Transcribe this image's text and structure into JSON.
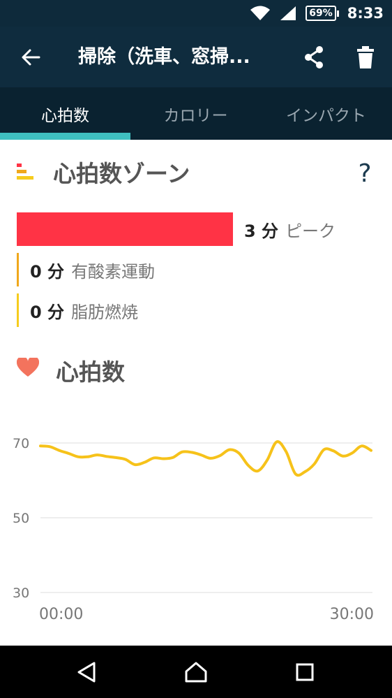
{
  "status": {
    "battery": "69%",
    "time": "8:33"
  },
  "appbar": {
    "title": "掃除（洗車、窓掃..."
  },
  "tabs": [
    {
      "label": "心拍数",
      "active": true
    },
    {
      "label": "カロリー",
      "active": false
    },
    {
      "label": "インパクト",
      "active": false
    }
  ],
  "zones": {
    "title": "心拍数ゾーン",
    "help": "?",
    "items": [
      {
        "value": "3 分",
        "label": "ピーク",
        "color": "#ff3345",
        "minutes": 3
      },
      {
        "value": "0 分",
        "label": "有酸素運動",
        "color": "#f0a81c",
        "minutes": 0
      },
      {
        "value": "0 分",
        "label": "脂肪燃焼",
        "color": "#f6cc1e",
        "minutes": 0
      }
    ]
  },
  "heart": {
    "title": "心拍数"
  },
  "chart_data": {
    "type": "line",
    "title": "",
    "xlabel": "",
    "ylabel": "",
    "ylim": [
      30,
      72
    ],
    "yticks": [
      70,
      50,
      30
    ],
    "xtick_labels": [
      "00:00",
      "30:00"
    ],
    "grid": true,
    "line_color": "#f6c21a",
    "series": [
      {
        "values": [
          [
            0,
            69.2
          ],
          [
            1,
            69.0
          ],
          [
            2,
            68.0
          ],
          [
            3,
            67.2
          ],
          [
            4,
            66.3
          ],
          [
            5,
            66.3
          ],
          [
            6,
            66.8
          ],
          [
            7,
            66.4
          ],
          [
            8,
            66.1
          ],
          [
            9,
            65.6
          ],
          [
            10,
            64.2
          ],
          [
            11,
            64.8
          ],
          [
            12,
            66.0
          ],
          [
            13,
            65.8
          ],
          [
            14,
            66.1
          ],
          [
            15,
            67.6
          ],
          [
            16,
            67.5
          ],
          [
            17,
            66.8
          ],
          [
            18,
            65.9
          ],
          [
            19,
            66.6
          ],
          [
            20,
            68.2
          ],
          [
            21,
            67.3
          ],
          [
            22,
            64.0
          ],
          [
            23,
            62.5
          ],
          [
            24,
            65.4
          ],
          [
            25,
            70.3
          ],
          [
            26,
            67.7
          ],
          [
            27,
            61.7
          ],
          [
            28,
            62.3
          ],
          [
            29,
            64.4
          ],
          [
            30,
            68.2
          ],
          [
            31,
            67.9
          ],
          [
            32,
            66.5
          ],
          [
            33,
            67.3
          ],
          [
            34,
            69.2
          ],
          [
            35,
            68.0
          ]
        ]
      }
    ]
  }
}
